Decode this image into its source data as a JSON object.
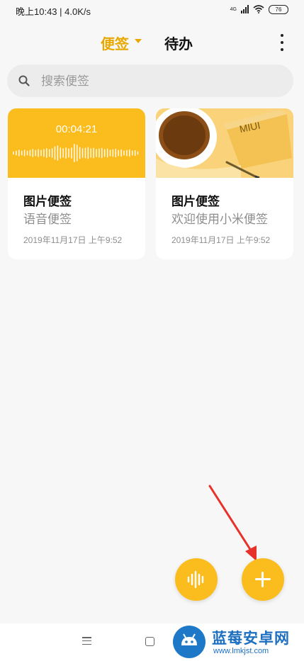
{
  "status_bar": {
    "time_speed": "晚上10:43 | 4.0K/s",
    "network": "4G",
    "battery": "76"
  },
  "header": {
    "tabs": [
      {
        "label": "便签",
        "active": true
      },
      {
        "label": "待办",
        "active": false
      }
    ]
  },
  "search": {
    "placeholder": "搜索便签"
  },
  "notes": [
    {
      "type": "voice",
      "duration": "00:04:21",
      "title": "图片便签",
      "subtitle": "语音便签",
      "date": "2019年11月17日 上午9:52"
    },
    {
      "type": "image",
      "image_text": "MIUI",
      "title": "图片便签",
      "subtitle": "欢迎使用小米便签",
      "date": "2019年11月17日 上午9:52"
    }
  ],
  "watermark": {
    "name": "蓝莓安卓网",
    "url": "www.lmkjst.com"
  },
  "colors": {
    "accent": "#fbbc1d",
    "active_tab": "#e8a800",
    "arrow": "#e8312a"
  }
}
